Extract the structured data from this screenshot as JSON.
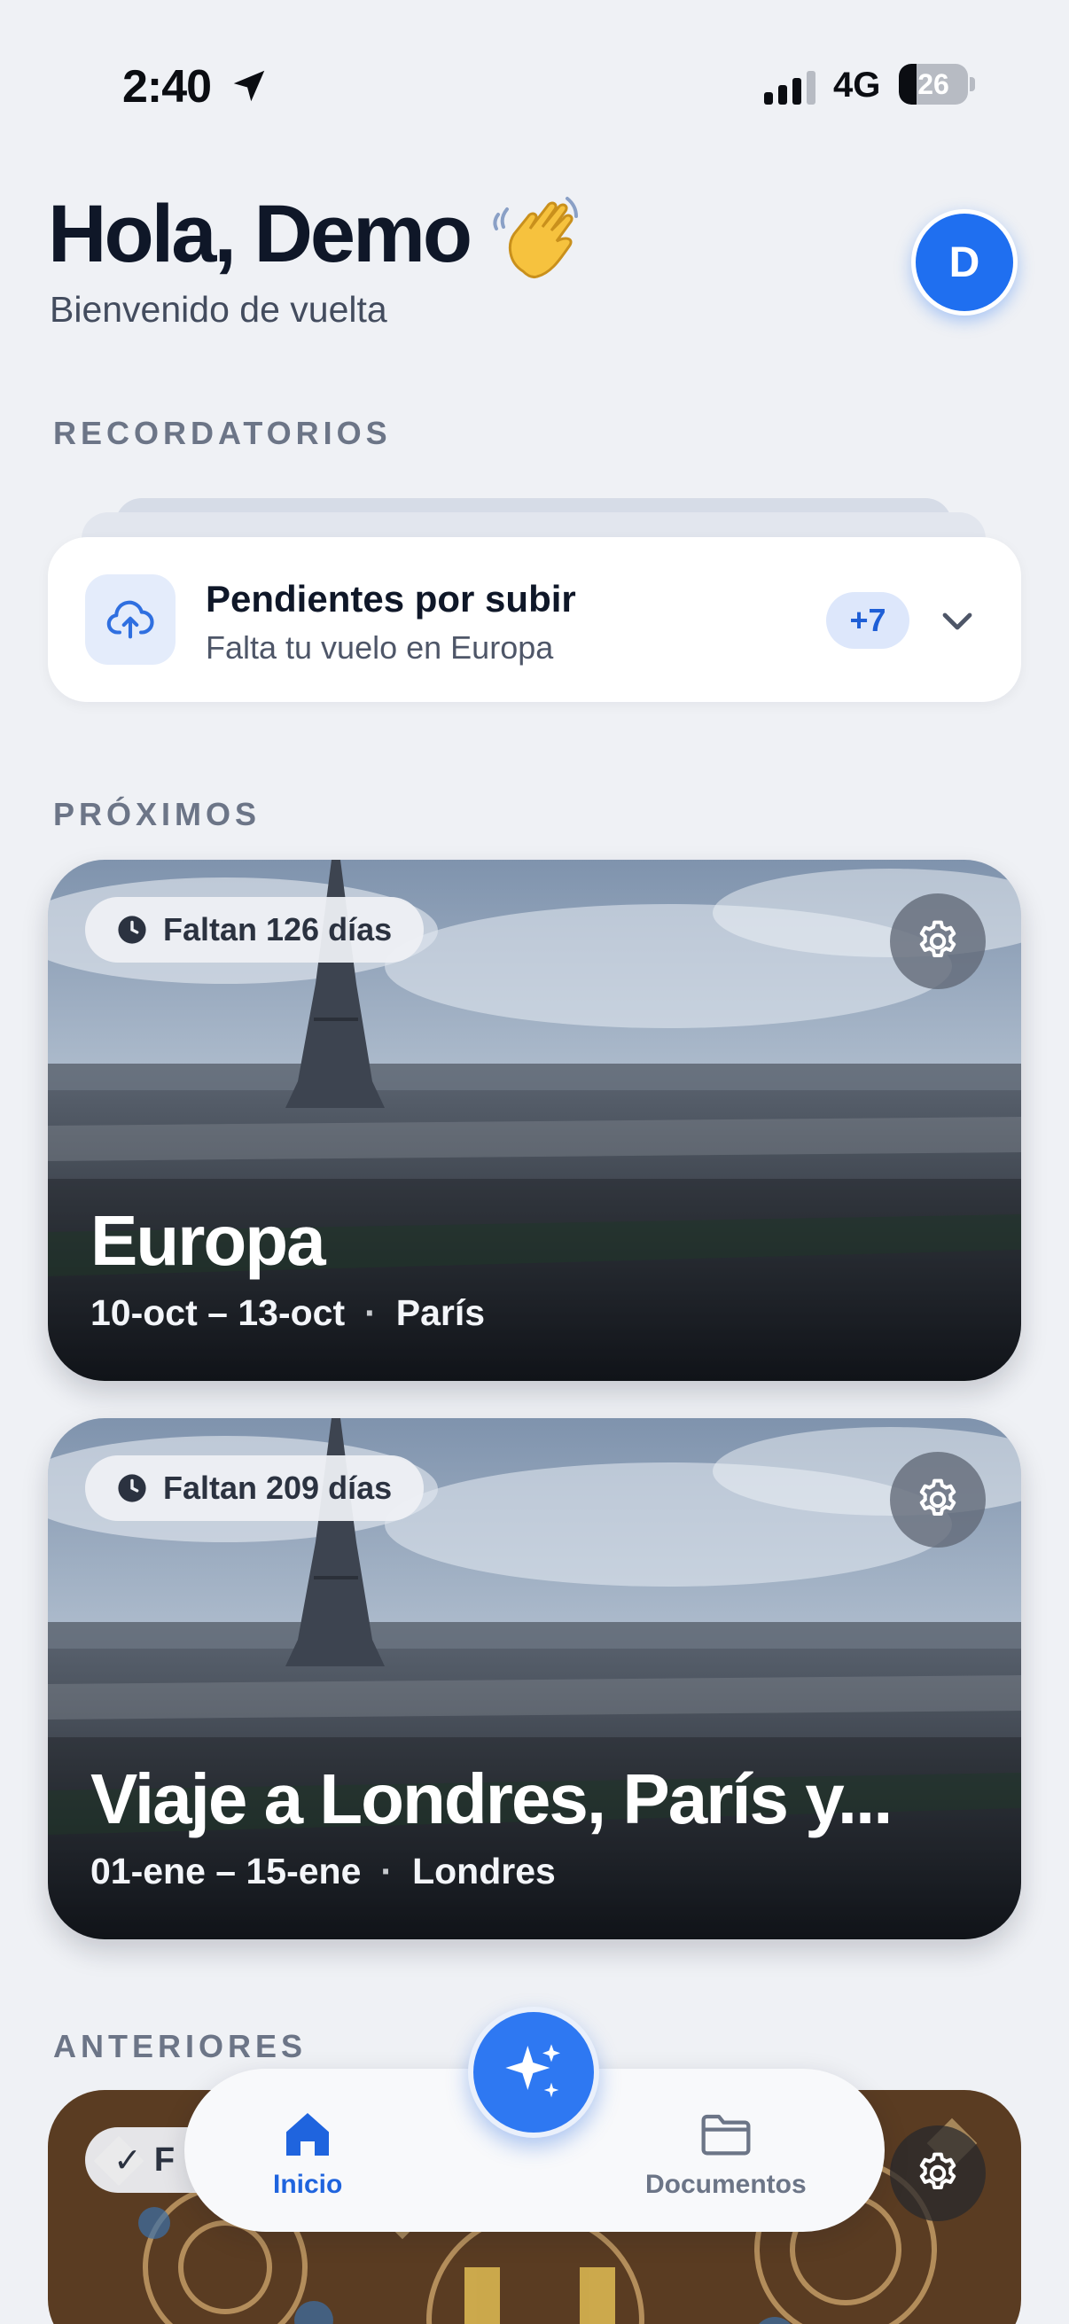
{
  "status_bar": {
    "time": "2:40",
    "network": "4G",
    "battery": "26",
    "battery_level": 0.26
  },
  "header": {
    "greeting": "Hola, Demo",
    "subtitle": "Bienvenido de vuelta",
    "avatar_initial": "D",
    "wave_icon": "waving-hand-icon"
  },
  "reminders": {
    "section_label": "RECORDATORIOS",
    "card": {
      "title": "Pendientes por subir",
      "subtitle": "Falta tu vuelo en Europa",
      "badge": "+7",
      "icon": "cloud-upload-icon"
    }
  },
  "upcoming": {
    "section_label": "PRÓXIMOS",
    "trips": [
      {
        "days_left": "Faltan 126 días",
        "title": "Europa",
        "dates": "10-oct – 13-oct",
        "separator": "·",
        "city": "París"
      },
      {
        "days_left": "Faltan 209 días",
        "title": "Viaje a Londres, París y...",
        "dates": "01-ene – 15-ene",
        "separator": "·",
        "city": "Londres"
      }
    ]
  },
  "previous": {
    "section_label": "ANTERIORES",
    "pill_text": "F",
    "pill_check": "✓"
  },
  "tabbar": {
    "home_label": "Inicio",
    "docs_label": "Documentos"
  },
  "colors": {
    "accent": "#1f6ff0",
    "background": "#eff1f5",
    "text_primary": "#0f1728"
  }
}
